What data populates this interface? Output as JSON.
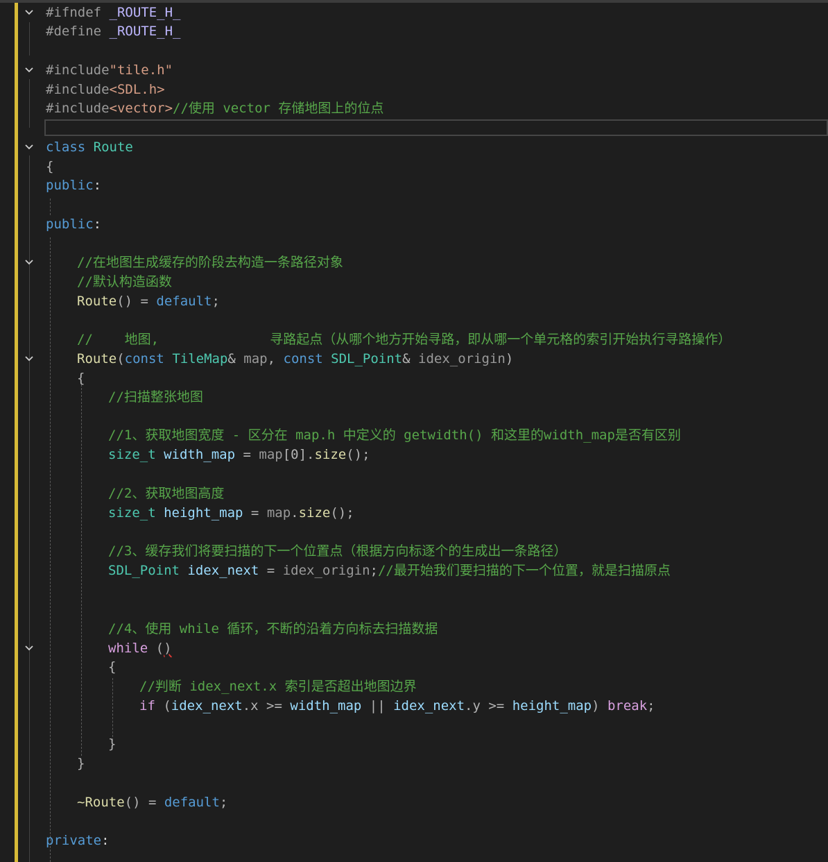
{
  "editor": {
    "colors": {
      "background": "#1e1e1e",
      "comment": "#57a64a",
      "keyword": "#569cd6",
      "type": "#4ec9b0",
      "function": "#dcdcaa",
      "variable": "#9cdcfe",
      "preprocessor": "#9b9b9b",
      "macro": "#beb7ff",
      "string": "#d69d85",
      "control_flow": "#d8a0df",
      "change_bar": "#d7ba38"
    },
    "fold_icon": "chevron-down-icon",
    "lines": [
      {
        "l1": "#ifndef",
        "l2": " _ROUTE_H_"
      },
      {
        "l1": "#define",
        "l2": " _ROUTE_H_"
      },
      {
        "l1": "#include",
        "l2": "\"tile.h\""
      },
      {
        "l1": "#include",
        "l2": "<SDL.h>"
      },
      {
        "l1": "#include",
        "l2": "<vector>",
        "l3": "//使用 vector 存储地图上的位点"
      },
      {
        "l1": "class",
        "l2": " ",
        "l3": "Route"
      },
      {
        "l1": "{"
      },
      {
        "l1": "public",
        "l2": ":"
      },
      {
        "l1": "public",
        "l2": ":"
      },
      {
        "l1": "//在地图生成缓存的阶段去构造一条路径对象"
      },
      {
        "l1": "//默认构造函数"
      },
      {
        "l1": "Route",
        "l2": "() = ",
        "l3": "default",
        "l4": ";"
      },
      {
        "l1": "//    地图,              寻路起点（从哪个地方开始寻路，即从哪一个单元格的索引开始执行寻路操作）"
      },
      {
        "l1": "Route",
        "l2": "(",
        "l3": "const",
        "l4": " ",
        "l5": "TileMap",
        "l6": "& ",
        "l7": "map",
        "l8": ", ",
        "l9": "const",
        "l10": " ",
        "l11": "SDL_Point",
        "l12": "& ",
        "l13": "idex_origin",
        "l14": ")"
      },
      {
        "l1": "{"
      },
      {
        "l1": "//扫描整张地图"
      },
      {
        "l1": "//1、获取地图宽度 - 区分在 map.h 中定义的 getwidth() 和这里的width_map是否有区别"
      },
      {
        "l1": "size_t",
        "l2": " ",
        "l3": "width_map",
        "l4": " = ",
        "l5": "map",
        "l6": "[0].",
        "l7": "size",
        "l8": "();"
      },
      {
        "l1": "//2、获取地图高度"
      },
      {
        "l1": "size_t",
        "l2": " ",
        "l3": "height_map",
        "l4": " = ",
        "l5": "map",
        "l6": ".",
        "l7": "size",
        "l8": "();"
      },
      {
        "l1": "//3、缓存我们将要扫描的下一个位置点（根据方向标逐个的生成出一条路径）"
      },
      {
        "l1": "SDL_Point",
        "l2": " ",
        "l3": "idex_next",
        "l4": " = ",
        "l5": "idex_origin",
        "l6": ";",
        "l7": "//最开始我们要扫描的下一个位置，就是扫描原点"
      },
      {
        "l1": "//4、使用 while 循环，不断的沿着方向标去扫描数据"
      },
      {
        "l1": "while",
        "l2": " (",
        "l3": ")"
      },
      {
        "l1": "{"
      },
      {
        "l1": "//判断 idex_next.x 索引是否超出地图边界"
      },
      {
        "l1": "if",
        "l2": " (",
        "l3": "idex_next",
        "l4": ".x >= ",
        "l5": "width_map",
        "l6": " || ",
        "l7": "idex_next",
        "l8": ".y >= ",
        "l9": "height_map",
        "l10": ") ",
        "l11": "break",
        "l12": ";"
      },
      {
        "l1": "}"
      },
      {
        "l1": "}"
      },
      {
        "l1": "~Route",
        "l2": "() = ",
        "l3": "default",
        "l4": ";"
      },
      {
        "l1": "private",
        "l2": ":"
      }
    ]
  }
}
